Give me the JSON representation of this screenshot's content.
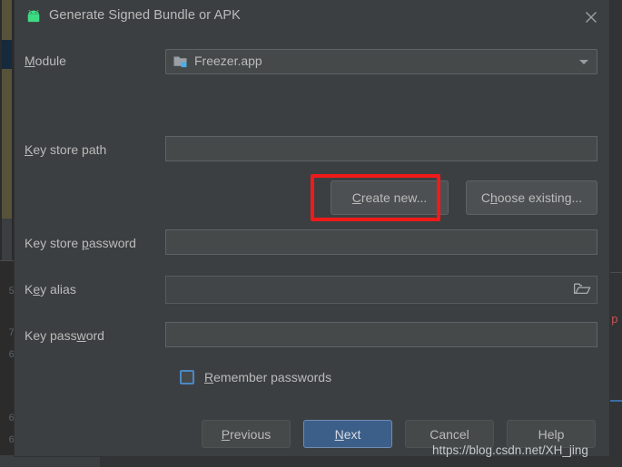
{
  "window": {
    "title": "Generate Signed Bundle or APK",
    "app_icon": "android-robot-icon",
    "close_icon": "close-icon"
  },
  "form": {
    "module": {
      "label_prefix": "",
      "label_mnemonic": "M",
      "label_suffix": "odule",
      "icon": "module-folder-icon",
      "value": "Freezer.app",
      "dropdown_icon": "chevron-down-icon"
    },
    "key_store_path": {
      "label_mnemonic": "K",
      "label_suffix": "ey store path",
      "value": ""
    },
    "key_store_password": {
      "label_prefix": "Key store ",
      "label_mnemonic": "p",
      "label_suffix": "assword",
      "value": ""
    },
    "key_alias": {
      "label_prefix": "K",
      "label_mnemonic": "e",
      "label_suffix": "y alias",
      "value": "",
      "browse_icon": "folder-open-icon"
    },
    "key_password": {
      "label_prefix": "Key pass",
      "label_mnemonic": "w",
      "label_suffix": "ord",
      "value": ""
    },
    "remember_passwords": {
      "label_mnemonic": "R",
      "label_suffix": "emember passwords",
      "checked": false
    }
  },
  "buttons": {
    "create_new": {
      "prefix": "",
      "mnemonic": "C",
      "suffix": "reate new...",
      "highlighted": true
    },
    "choose_existing": {
      "prefix": "C",
      "mnemonic": "h",
      "suffix": "oose existing..."
    },
    "previous": {
      "prefix": "",
      "mnemonic": "P",
      "suffix": "revious"
    },
    "next": {
      "prefix": "",
      "mnemonic": "N",
      "suffix": "ext",
      "primary": true
    },
    "cancel": {
      "prefix": "Cancel",
      "mnemonic": "",
      "suffix": ""
    },
    "help": {
      "prefix": "Help",
      "mnemonic": "",
      "suffix": ""
    }
  },
  "annotation": {
    "highlight_color": "#f01a1a",
    "target": "Create new..."
  },
  "watermark": {
    "text": "https://blog.csdn.net/XH_jing"
  },
  "background": {
    "line_numbers": [
      "5",
      "7",
      "6",
      "6",
      "6"
    ],
    "red_char": "p"
  },
  "colors": {
    "dialog_bg": "#3c3f41",
    "field_bg": "#45494a",
    "text": "#bbbbbb",
    "accent_blue": "#3c5f8a",
    "checkbox_focus": "#4a88c7",
    "annotation_red": "#f01a1a",
    "android_green": "#3ddc84"
  }
}
